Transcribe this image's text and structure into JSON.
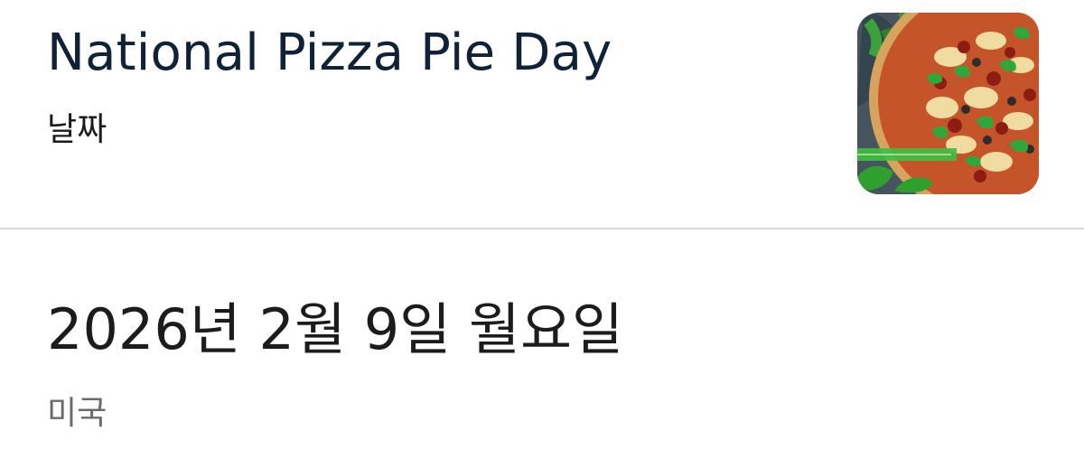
{
  "event": {
    "title": "National Pizza Pie Day",
    "label": "날짜",
    "image_alt": "pizza-image"
  },
  "details": {
    "date": "2026년 2월 9일 월요일",
    "region": "미국"
  },
  "colors": {
    "title": "#0f2238",
    "text": "#1c1c1c",
    "muted": "#6b6b6b",
    "divider": "#d9d9d9",
    "background": "#ffffff"
  }
}
